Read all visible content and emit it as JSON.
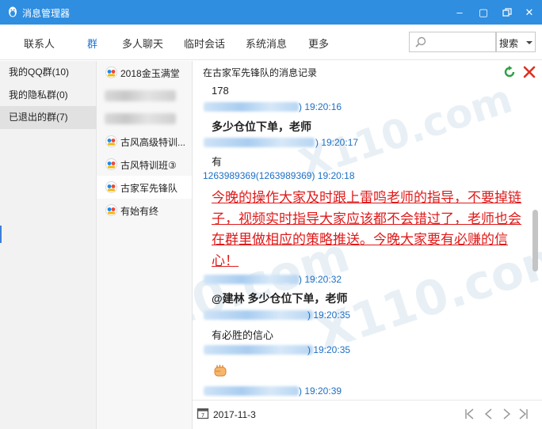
{
  "window": {
    "title": "消息管理器",
    "minimize_glyph": "–",
    "maximize_glyph": "▢",
    "close_glyph": "✕"
  },
  "tabs": [
    {
      "label": "联系人",
      "active": false
    },
    {
      "label": "群",
      "active": true
    },
    {
      "label": "多人聊天",
      "active": false
    },
    {
      "label": "临时会话",
      "active": false
    },
    {
      "label": "系统消息",
      "active": false
    },
    {
      "label": "更多",
      "active": false
    }
  ],
  "search": {
    "placeholder": "",
    "scope_label": "搜索"
  },
  "sidebar": {
    "items": [
      {
        "label": "我的QQ群(10)",
        "active": false
      },
      {
        "label": "我的隐私群(0)",
        "active": false
      },
      {
        "label": "已退出的群(7)",
        "active": true
      }
    ]
  },
  "groups": [
    {
      "label": "2018金玉满堂",
      "blurred": false,
      "active": false
    },
    {
      "label": "",
      "blurred": true,
      "active": false
    },
    {
      "label": "",
      "blurred": true,
      "active": false
    },
    {
      "label": "古风高级特训...",
      "blurred": false,
      "active": false
    },
    {
      "label": "古风特训班③",
      "blurred": false,
      "active": false
    },
    {
      "label": "古家军先锋队",
      "blurred": false,
      "active": true
    },
    {
      "label": "有始有终",
      "blurred": false,
      "active": false
    }
  ],
  "content": {
    "header": "在古家军先锋队的消息记录",
    "messages": [
      {
        "text": "178"
      },
      {
        "sender_suffix": ") 19:20:16"
      },
      {
        "text": "多少仓位下单，老师"
      },
      {
        "sender_suffix": ") 19:20:17"
      },
      {
        "text": "有"
      },
      {
        "sender": "1263989369(1263989369) 19:20:18"
      },
      {
        "text": "今晚的操作大家及时跟上雷鸣老师的指导，不要掉链子，视频实时指导大家应该都不会错过了，老师也会在群里做相应的策略推送。今晚大家要有必赚的信心！"
      },
      {
        "sender_suffix": ") 19:20:32"
      },
      {
        "text": "@建林 多少仓位下单，老师"
      },
      {
        "sender_suffix": ") 19:20:35"
      },
      {
        "text": "有必胜的信心"
      },
      {
        "sender_suffix": ") 19:20:35"
      },
      {
        "sender_suffix": ") 19:20:39"
      }
    ]
  },
  "footer": {
    "date": "2017-11-3"
  },
  "colors": {
    "titlebar": "#2f8ee0",
    "active_tab": "#1e76d4",
    "sender_blue": "#1d6fc4",
    "highlight_red": "#e01a1a"
  }
}
